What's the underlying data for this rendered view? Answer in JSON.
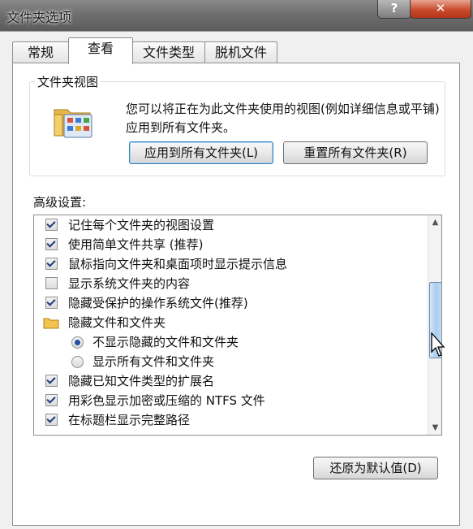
{
  "window": {
    "title": "文件夹选项",
    "help_label": "?",
    "close_label": "✕"
  },
  "tabs": [
    {
      "label": "常规",
      "active": false
    },
    {
      "label": "查看",
      "active": true
    },
    {
      "label": "文件类型",
      "active": false
    },
    {
      "label": "脱机文件",
      "active": false
    }
  ],
  "folder_view": {
    "title": "文件夹视图",
    "description": "您可以将正在为此文件夹使用的视图(例如详细信息或平铺)应用到所有文件夹。",
    "apply_button": "应用到所有文件夹(L)",
    "reset_button": "重置所有文件夹(R)"
  },
  "advanced": {
    "label": "高级设置:",
    "items": [
      {
        "type": "checkbox",
        "checked": true,
        "label": "记住每个文件夹的视图设置"
      },
      {
        "type": "checkbox",
        "checked": true,
        "label": "使用简单文件共享 (推荐)"
      },
      {
        "type": "checkbox",
        "checked": true,
        "label": "鼠标指向文件夹和桌面项时显示提示信息"
      },
      {
        "type": "checkbox",
        "checked": false,
        "label": "显示系统文件夹的内容"
      },
      {
        "type": "checkbox",
        "checked": true,
        "label": "隐藏受保护的操作系统文件(推荐)"
      },
      {
        "type": "folder",
        "label": "隐藏文件和文件夹"
      },
      {
        "type": "radio",
        "checked": true,
        "label": "不显示隐藏的文件和文件夹"
      },
      {
        "type": "radio",
        "checked": false,
        "label": "显示所有文件和文件夹"
      },
      {
        "type": "checkbox",
        "checked": true,
        "label": "隐藏已知文件类型的扩展名"
      },
      {
        "type": "checkbox",
        "checked": true,
        "label": "用彩色显示加密或压缩的 NTFS 文件"
      },
      {
        "type": "checkbox",
        "checked": true,
        "label": "在标题栏显示完整路径"
      }
    ],
    "restore_button": "还原为默认值(D)"
  },
  "colors": {
    "close": "#c94b2d",
    "thumb": "#a9cdef",
    "check": "#1f3a7a"
  }
}
